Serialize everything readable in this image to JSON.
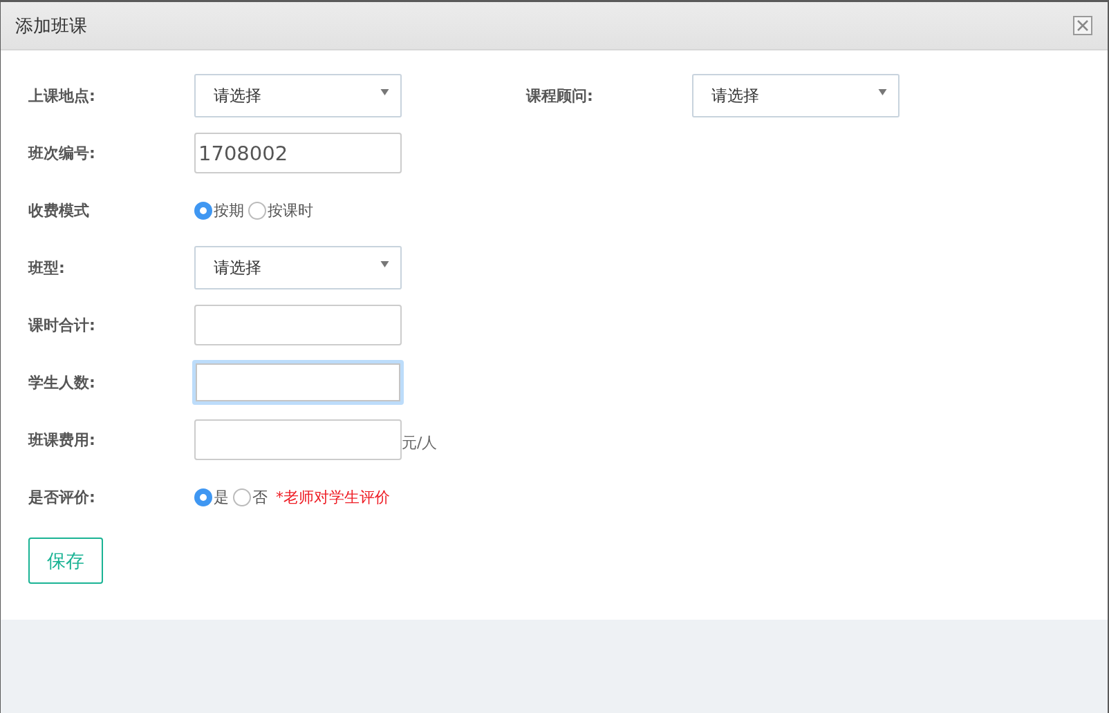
{
  "dialog": {
    "title": "添加班课"
  },
  "rows": [
    {
      "label": "上课地点:",
      "field": {
        "kind": "select",
        "value": "请选择"
      },
      "second": {
        "label": "课程顾问:",
        "field": {
          "kind": "select",
          "value": "请选择"
        }
      }
    },
    {
      "label": "班次编号:",
      "field": {
        "kind": "text",
        "value": "1708002",
        "focused": false
      }
    },
    {
      "label": "收费模式",
      "field": {
        "kind": "radio",
        "options": [
          {
            "label": "按期",
            "selected": true
          },
          {
            "label": "按课时",
            "selected": false
          }
        ]
      }
    },
    {
      "label": "班型:",
      "field": {
        "kind": "select",
        "value": "请选择"
      }
    },
    {
      "label": "课时合计:",
      "field": {
        "kind": "text",
        "focused": false
      }
    },
    {
      "label": "学生人数:",
      "field": {
        "kind": "text",
        "focused": true
      }
    },
    {
      "label": "班课费用:",
      "field": {
        "kind": "text",
        "focused": false,
        "suffix": "元/人"
      }
    },
    {
      "label": "是否评价:",
      "field": {
        "kind": "radio",
        "options": [
          {
            "label": "是",
            "selected": true
          },
          {
            "label": "否",
            "selected": false
          }
        ],
        "note": "*老师对学生评价"
      }
    }
  ],
  "buttons": [
    "保存"
  ]
}
